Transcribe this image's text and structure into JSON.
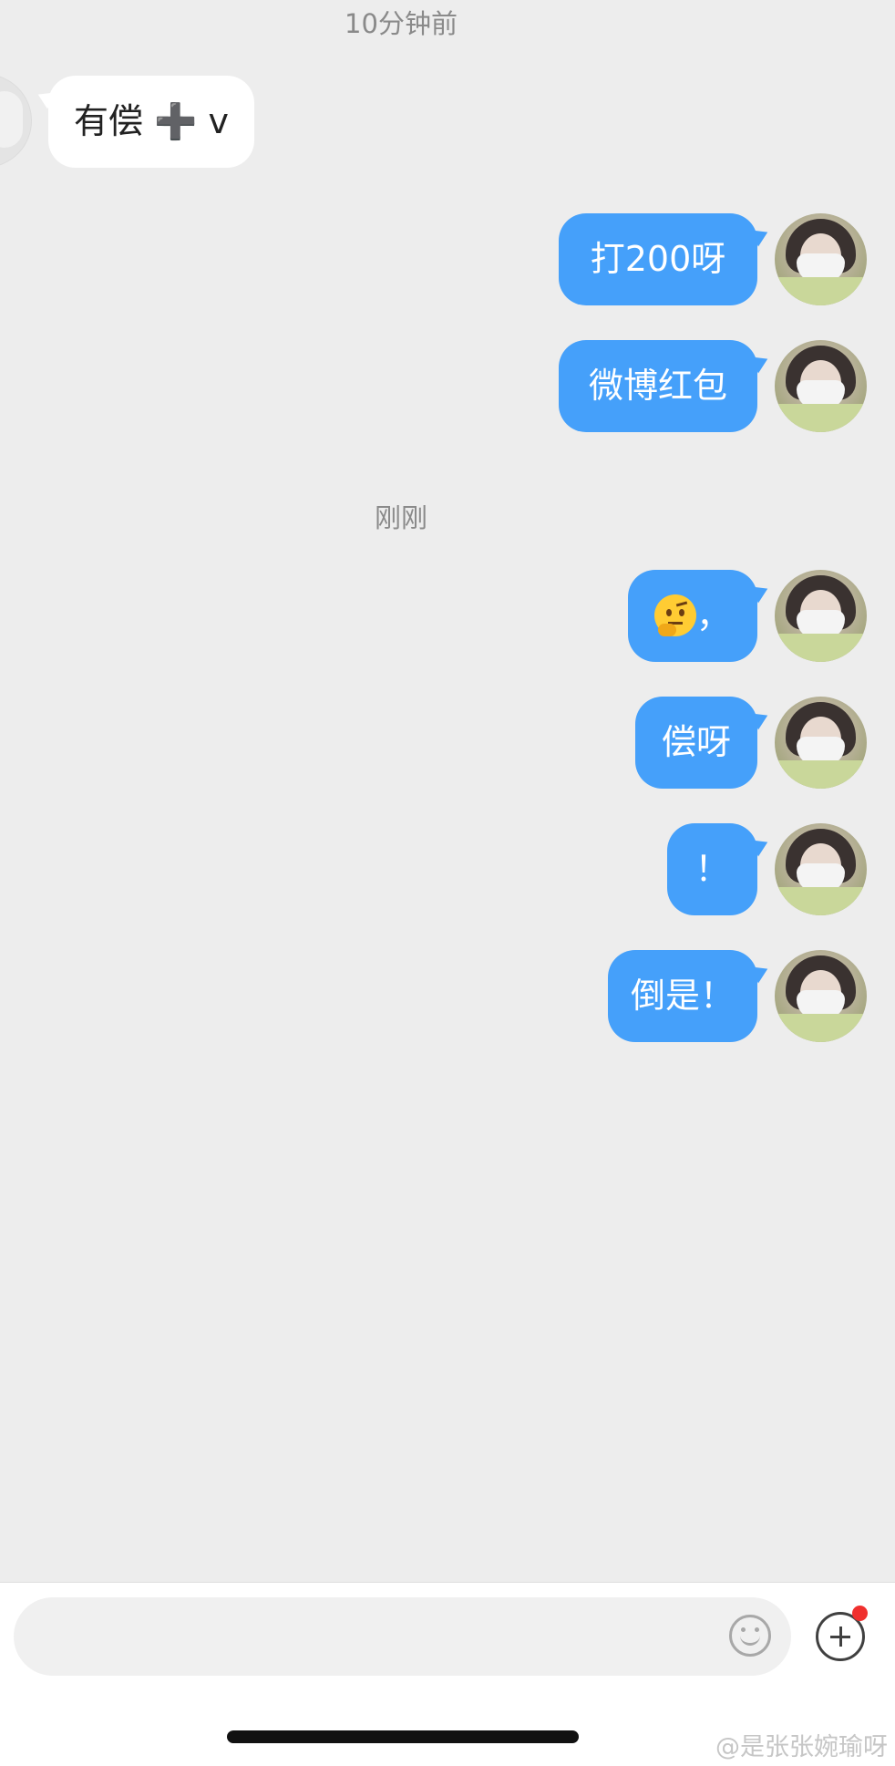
{
  "timestamps": [
    "10分钟前",
    "刚刚"
  ],
  "messages": [
    {
      "sender": "other",
      "text": "有偿 ➕ v"
    },
    {
      "sender": "self",
      "text": "打200呀"
    },
    {
      "sender": "self",
      "text": "微博红包"
    },
    {
      "sender": "self",
      "emoji": "thinking-face",
      "text": "，"
    },
    {
      "sender": "self",
      "text": "偿呀"
    },
    {
      "sender": "self",
      "text": "！"
    },
    {
      "sender": "self",
      "text": "倒是！"
    }
  ],
  "input": {
    "value": "",
    "placeholder": ""
  },
  "icons": {
    "emoji": "smiley-icon",
    "more": "plus-circle-icon"
  },
  "notification": true,
  "watermark": "@是张张婉瑜呀",
  "colors": {
    "background": "#ededed",
    "self_bubble": "#45a0fa",
    "other_bubble": "#ffffff",
    "timestamp": "#8a8a8a",
    "notification_dot": "#f0302e"
  }
}
